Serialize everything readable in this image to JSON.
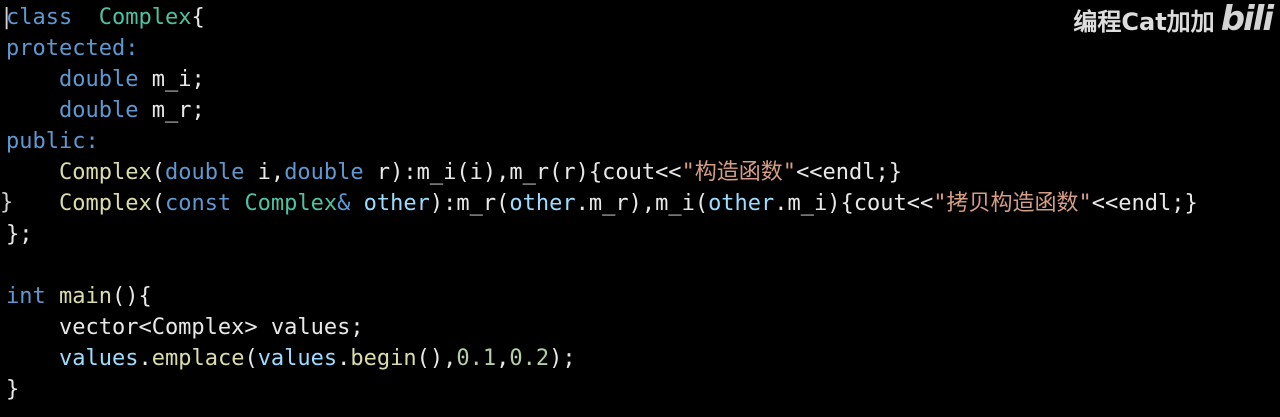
{
  "watermark": {
    "channel_name": "编程Cat加加",
    "logo_text": "bili"
  },
  "colors": {
    "background": "#000000",
    "keyword": "#5f98cf",
    "type": "#4fc1a3",
    "function": "#dcdcaa",
    "string": "#d69d85",
    "number": "#b5cea8",
    "parameter": "#9cdcfe",
    "plain": "#e8e8e8"
  },
  "code": {
    "lines": [
      [
        {
          "t": "class",
          "c": "kw"
        },
        {
          "t": "  ",
          "c": "plain"
        },
        {
          "t": "Complex",
          "c": "ty"
        },
        {
          "t": "{",
          "c": "punct"
        }
      ],
      [
        {
          "t": "protected:",
          "c": "kw"
        }
      ],
      [
        {
          "t": "    ",
          "c": "plain"
        },
        {
          "t": "double",
          "c": "kw"
        },
        {
          "t": " m_i;",
          "c": "plain"
        }
      ],
      [
        {
          "t": "    ",
          "c": "plain"
        },
        {
          "t": "double",
          "c": "kw"
        },
        {
          "t": " m_r;",
          "c": "plain"
        }
      ],
      [
        {
          "t": "public:",
          "c": "kw"
        }
      ],
      [
        {
          "t": "    ",
          "c": "plain"
        },
        {
          "t": "Complex",
          "c": "fn"
        },
        {
          "t": "(",
          "c": "punct"
        },
        {
          "t": "double",
          "c": "kw"
        },
        {
          "t": " i,",
          "c": "plain"
        },
        {
          "t": "double",
          "c": "kw"
        },
        {
          "t": " r):m_i(i),m_r(r){cout<<",
          "c": "plain"
        },
        {
          "t": "\"构造函数\"",
          "c": "str"
        },
        {
          "t": "<<endl;}",
          "c": "plain"
        }
      ],
      [
        {
          "t": "    ",
          "c": "plain"
        },
        {
          "t": "Complex",
          "c": "fn"
        },
        {
          "t": "(",
          "c": "punct"
        },
        {
          "t": "const",
          "c": "kw"
        },
        {
          "t": " ",
          "c": "plain"
        },
        {
          "t": "Complex",
          "c": "ty"
        },
        {
          "t": "&",
          "c": "kw"
        },
        {
          "t": " ",
          "c": "plain"
        },
        {
          "t": "other",
          "c": "par"
        },
        {
          "t": "):m_r(",
          "c": "plain"
        },
        {
          "t": "other",
          "c": "par"
        },
        {
          "t": ".m_r),m_i(",
          "c": "plain"
        },
        {
          "t": "other",
          "c": "par"
        },
        {
          "t": ".m_i){cout<<",
          "c": "plain"
        },
        {
          "t": "\"拷贝构造函数\"",
          "c": "str"
        },
        {
          "t": "<<endl;}",
          "c": "plain"
        }
      ],
      [
        {
          "t": "};",
          "c": "plain"
        }
      ],
      [],
      [
        {
          "t": "int",
          "c": "kw"
        },
        {
          "t": " ",
          "c": "plain"
        },
        {
          "t": "main",
          "c": "fn"
        },
        {
          "t": "(){",
          "c": "plain"
        }
      ],
      [
        {
          "t": "    vector<Complex> values;",
          "c": "plain"
        }
      ],
      [
        {
          "t": "    ",
          "c": "plain"
        },
        {
          "t": "values",
          "c": "par"
        },
        {
          "t": ".",
          "c": "plain"
        },
        {
          "t": "emplace",
          "c": "fn"
        },
        {
          "t": "(",
          "c": "plain"
        },
        {
          "t": "values",
          "c": "par"
        },
        {
          "t": ".",
          "c": "plain"
        },
        {
          "t": "begin",
          "c": "fn"
        },
        {
          "t": "(),",
          "c": "plain"
        },
        {
          "t": "0.1",
          "c": "num"
        },
        {
          "t": ",",
          "c": "plain"
        },
        {
          "t": "0.2",
          "c": "num"
        },
        {
          "t": ");",
          "c": "plain"
        }
      ],
      [
        {
          "t": "}",
          "c": "plain"
        }
      ]
    ]
  }
}
